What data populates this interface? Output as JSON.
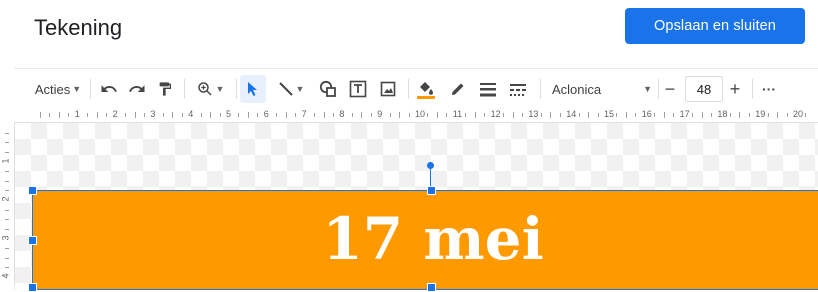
{
  "header": {
    "title": "Tekening",
    "save_label": "Opslaan en sluiten"
  },
  "toolbar": {
    "actions_label": "Acties",
    "font_name": "Aclonica",
    "font_size": "48",
    "minus": "−",
    "plus": "+",
    "more": "···",
    "selected_tool": "select",
    "fill_color": "#ff9900"
  },
  "ruler": {
    "numbers": [
      "1",
      "2",
      "3",
      "4",
      "5",
      "6",
      "7",
      "8",
      "9",
      "10",
      "11",
      "12",
      "13",
      "14",
      "15",
      "16",
      "17",
      "18",
      "19",
      "20"
    ],
    "vertical_numbers": [
      "1",
      "2",
      "3",
      "4"
    ]
  },
  "drawing": {
    "shape_text": "17 mei",
    "shape_color": "#ff9900",
    "selection_color": "#1a73e8"
  }
}
